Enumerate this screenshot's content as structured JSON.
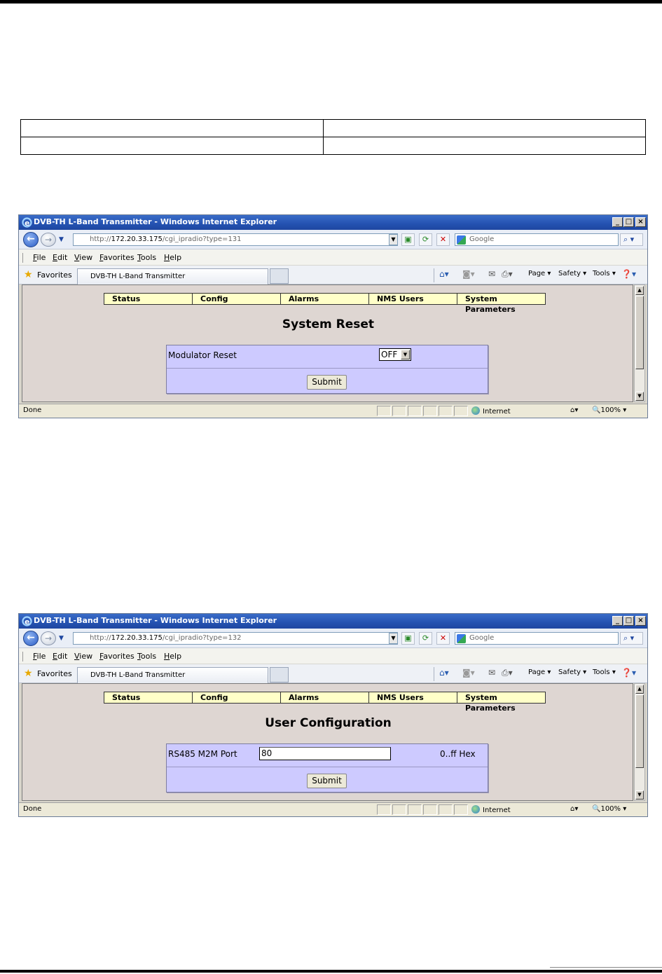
{
  "windows": [
    {
      "title": "DVB-TH L-Band Transmitter - Windows Internet Explorer",
      "url_prefix": "http://",
      "url_host": "172.20.33.175",
      "url_path": "/cgi_ipradio?type=131",
      "search_placeholder": "Google",
      "menu": [
        "File",
        "Edit",
        "View",
        "Favorites",
        "Tools",
        "Help"
      ],
      "favorites_label": "Favorites",
      "tab_title": "DVB-TH L-Band Transmitter",
      "commands": {
        "page": "Page",
        "safety": "Safety",
        "tools": "Tools"
      },
      "nav": [
        "Status",
        "Config",
        "Alarms",
        "NMS Users",
        "System Parameters"
      ],
      "heading": "System Reset",
      "field_label": "Modulator Reset",
      "select_value": "OFF",
      "submit_label": "Submit",
      "status_text": "Done",
      "zone": "Internet",
      "zoom": "100%"
    },
    {
      "title": "DVB-TH L-Band Transmitter - Windows Internet Explorer",
      "url_prefix": "http://",
      "url_host": "172.20.33.175",
      "url_path": "/cgi_ipradio?type=132",
      "search_placeholder": "Google",
      "menu": [
        "File",
        "Edit",
        "View",
        "Favorites",
        "Tools",
        "Help"
      ],
      "favorites_label": "Favorites",
      "tab_title": "DVB-TH L-Band Transmitter",
      "commands": {
        "page": "Page",
        "safety": "Safety",
        "tools": "Tools"
      },
      "nav": [
        "Status",
        "Config",
        "Alarms",
        "NMS Users",
        "System Parameters"
      ],
      "heading": "User Configuration",
      "field_label": "RS485 M2M Port",
      "input_value": "80",
      "hint": "0..ff Hex",
      "submit_label": "Submit",
      "status_text": "Done",
      "zone": "Internet",
      "zoom": "100%"
    }
  ]
}
